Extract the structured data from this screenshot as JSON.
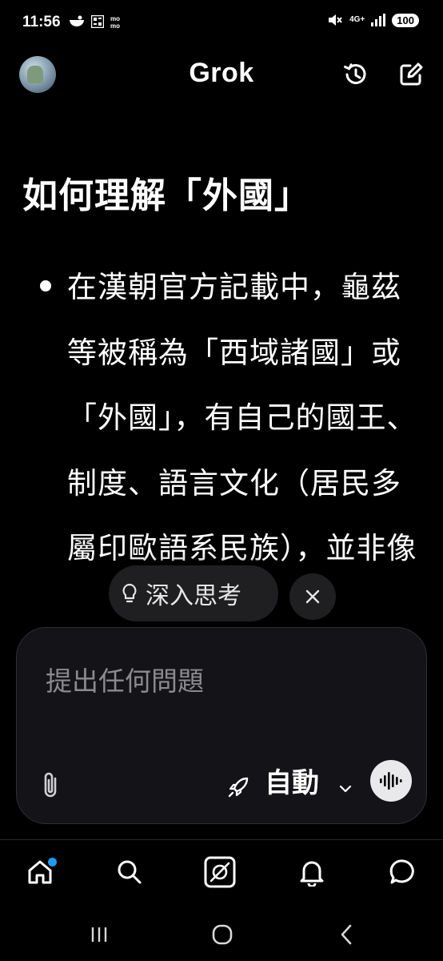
{
  "status_bar": {
    "time": "11:56",
    "network": "4G+",
    "battery": "100",
    "icons": [
      "bowl-icon",
      "qr-icon",
      "momo-icon",
      "mute-icon",
      "signal-icon"
    ]
  },
  "header": {
    "title": "Grok",
    "icons": [
      "avatar",
      "history-icon",
      "edit-icon"
    ]
  },
  "content": {
    "heading": "如何理解「外國」",
    "bullet_text": "在漢朝官方記載中，龜茲等被稱為「西域諸國」或「外國」，有自己的國王、制度、語言文化（居民多屬印歐語系民族），並非像"
  },
  "suggestion": {
    "deep_think_label": "深入思考",
    "close_icon": "close-icon",
    "bulb_icon": "lightbulb-icon"
  },
  "composer": {
    "placeholder": "提出任何問題",
    "value": "",
    "mode_label": "自動",
    "icons": [
      "paperclip-icon",
      "rocket-icon",
      "chevron-down-icon",
      "voice-wave-icon"
    ]
  },
  "bottom_nav": {
    "items": [
      "home-icon",
      "search-icon",
      "grok-icon",
      "bell-icon",
      "chat-icon"
    ],
    "active_dot_color": "#1d9bf0"
  },
  "system_nav": [
    "recents-icon",
    "home-circle-icon",
    "back-icon"
  ],
  "colors": {
    "background": "#000000",
    "composer_bg": "#141418",
    "chip_bg": "#1f1f22",
    "placeholder": "#8a8a8f"
  }
}
